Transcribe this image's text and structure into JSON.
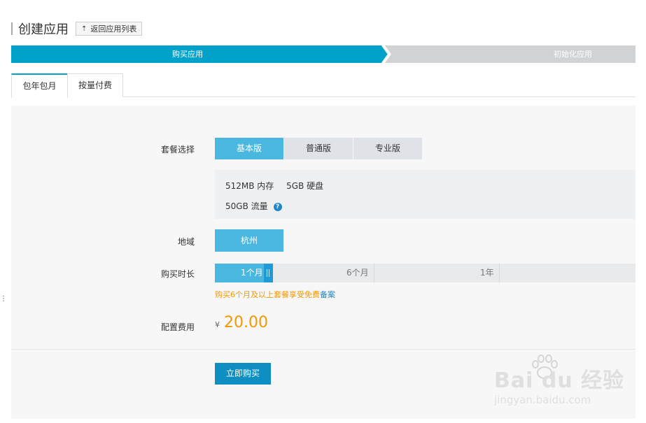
{
  "header": {
    "title": "创建应用",
    "back_label": "返回应用列表"
  },
  "steps": [
    {
      "label": "购买应用",
      "state": "active",
      "color": "#00a2ca"
    },
    {
      "label": "初始化应用",
      "state": "inactive",
      "color": "#d0d2d4"
    }
  ],
  "tabs": [
    {
      "label": "包年包月",
      "active": true
    },
    {
      "label": "按量付费",
      "active": false
    }
  ],
  "form": {
    "package": {
      "label": "套餐选择",
      "options": [
        "基本版",
        "普通版",
        "专业版"
      ],
      "selected": "基本版",
      "memory": "512MB 内存",
      "disk": "5GB 硬盘",
      "traffic": "50GB 流量"
    },
    "region": {
      "label": "地域",
      "value": "杭州"
    },
    "duration": {
      "label": "购买时长",
      "options": [
        "1个月",
        "6个月",
        "1年"
      ],
      "selected": "1个月",
      "promo_text": "购买6个月及以上套餐享受免费",
      "promo_link": "备案"
    },
    "price": {
      "label": "配置费用",
      "currency": "¥",
      "amount": "20.00"
    },
    "submit_label": "立即购买"
  },
  "watermark": {
    "logo": "Bai du 经验",
    "url": "jingyan.baidu.com"
  },
  "colors": {
    "accent": "#4ab7e0",
    "primary": "#0f8fc1",
    "price": "#f39800",
    "link": "#1f87c9"
  }
}
